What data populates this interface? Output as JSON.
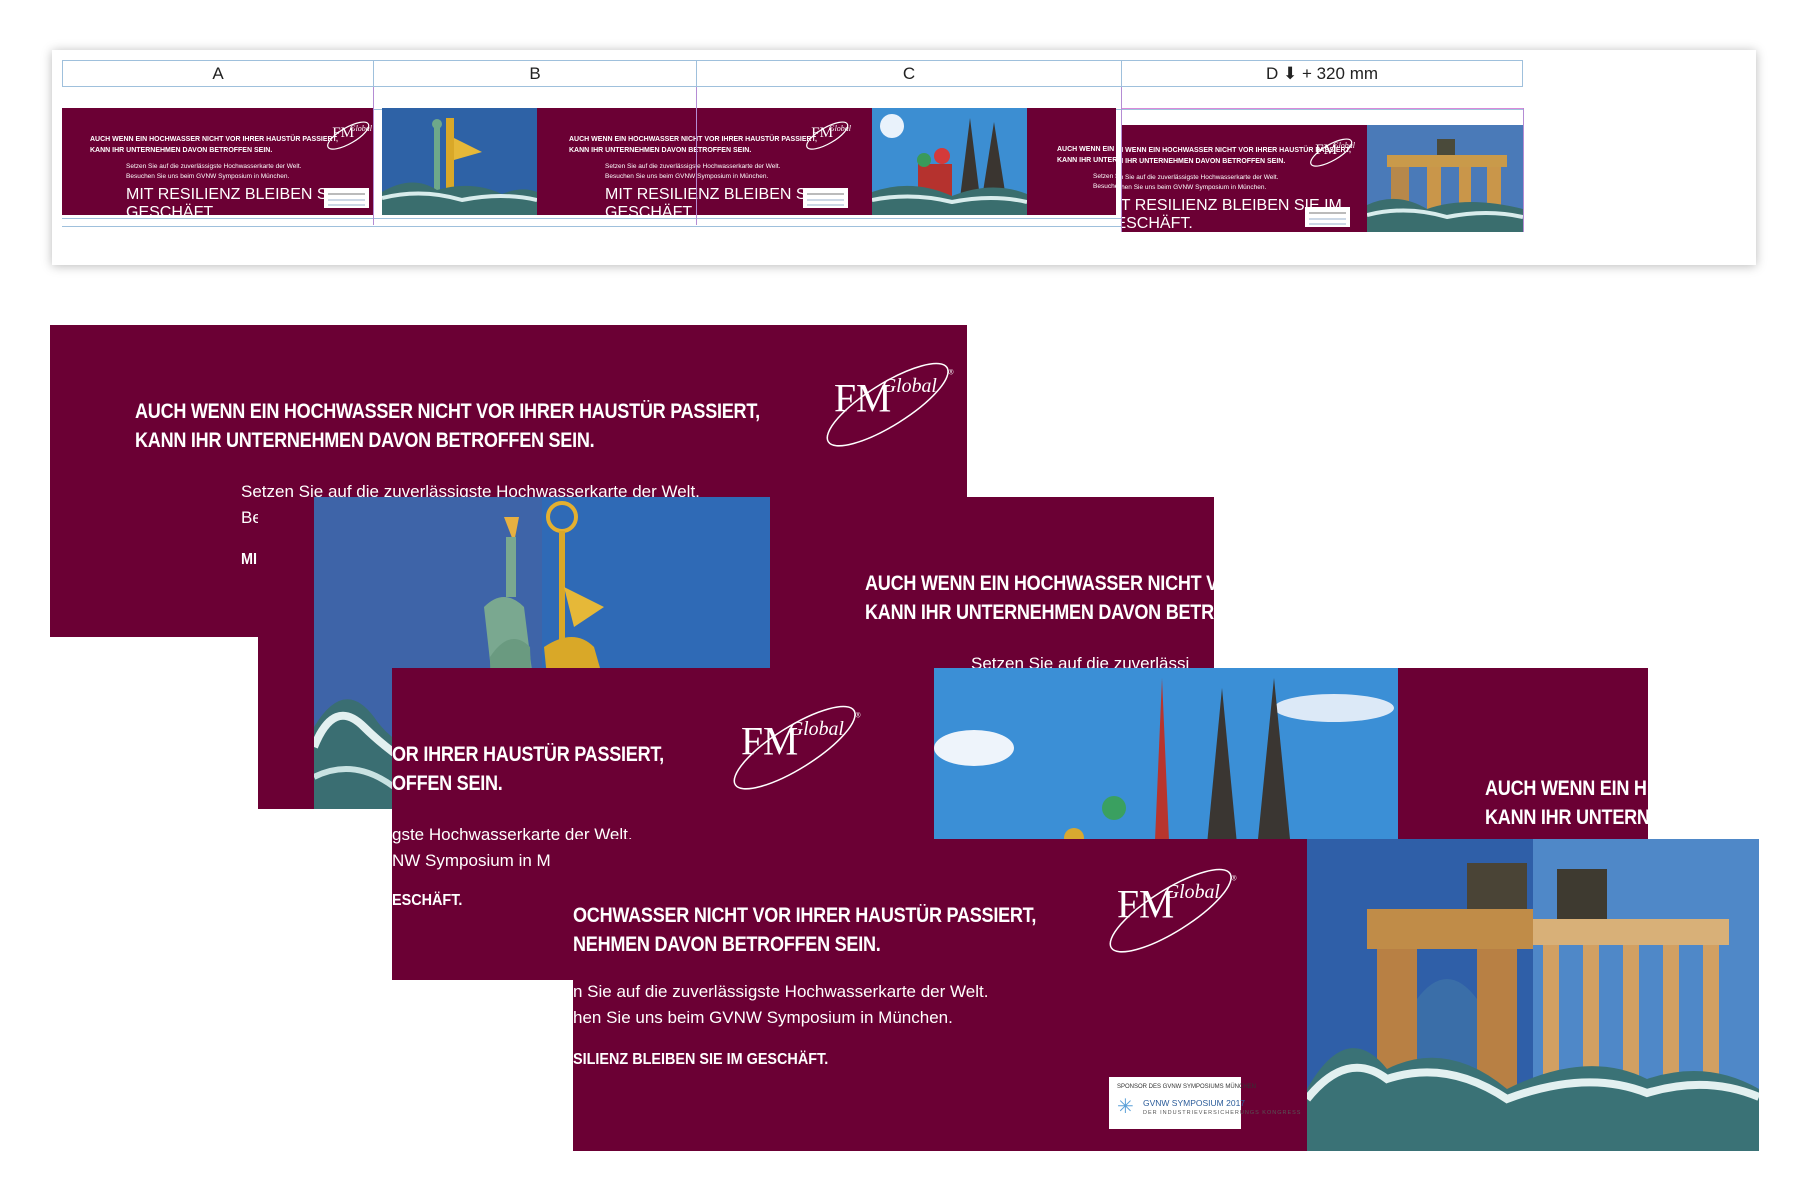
{
  "columns": [
    "A",
    "B",
    "C",
    "D ⬇ + 320 mm"
  ],
  "ad": {
    "headline_line1": "AUCH WENN EIN HOCHWASSER NICHT VOR IHRER HAUSTÜR PASSIERT,",
    "headline_line2": "KANN IHR UNTERNEHMEN DAVON BETROFFEN SEIN.",
    "body_line1": "Setzen Sie auf die zuverlässigste Hochwasserkarte der Welt.",
    "body_line2": "Besuchen Sie uns beim GVNW Symposium in München.",
    "slogan": "MIT RESILIENZ BLEIBEN SIE IM GESCHÄFT."
  },
  "crops": {
    "banner2_headline1": "AUCH WENN EIN HOCHWASSER NICHT V",
    "banner2_headline2": "KANN IHR UNTERNEHMEN DAVON BETR",
    "banner2_body1": "Setzen Sie auf die zuverlässi",
    "banner1_body2": "Be",
    "banner1_slogan": "MI",
    "banner3_headline1": "OR IHRER HAUSTÜR PASSIERT,",
    "banner3_headline2": "OFFEN SEIN.",
    "banner3_body1": "gste Hochwasserkarte der Welt.",
    "banner3_body2": "NW Symposium in M",
    "banner3_slogan": "ESCHÄFT.",
    "banner3_right1": "AUCH WENN EIN H",
    "banner3_right2": "KANN IHR UNTERN",
    "banner4_headline1": "OCHWASSER NICHT VOR IHRER HAUSTÜR PASSIERT,",
    "banner4_headline2": "NEHMEN DAVON BETROFFEN SEIN.",
    "banner4_body1": "n Sie auf die zuverlässigste Hochwasserkarte der Welt.",
    "banner4_body2": "hen Sie uns beim GVNW Symposium in München.",
    "banner4_slogan": "SILIENZ BLEIBEN SIE IM GESCHÄFT."
  },
  "logo": {
    "fm": "FM",
    "global": "Global",
    "reg": "®"
  },
  "sponsor": {
    "line1": "SPONSOR DES GVNW SYMPOSIUMS MÜNCHEN",
    "line2": "GVNW SYMPOSIUM 2017",
    "line3": "DER INDUSTRIEVERSICHERUNGS KONGRESS"
  },
  "colors": {
    "maroon": "#6b0034",
    "guide_blue": "#9fc0dc",
    "guide_purple": "#b48cd4"
  },
  "images": [
    "statue-of-liberty-victory-column",
    "st-basil-cologne-cathedral",
    "arc-de-triomphe-brandenburg-gate"
  ]
}
